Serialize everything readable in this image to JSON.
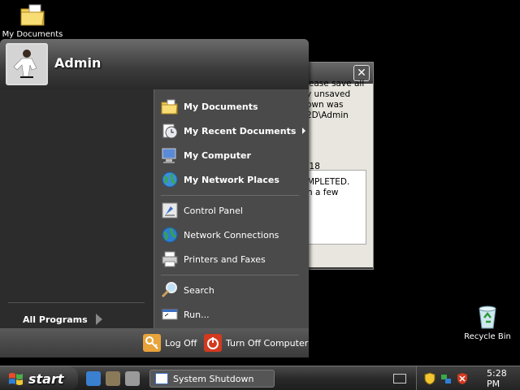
{
  "desktop": {
    "icons": [
      {
        "label": "My Documents",
        "icon": "folder-documents-icon"
      },
      {
        "label": "Recycle Bin",
        "icon": "recycle-bin-icon"
      }
    ]
  },
  "dialog": {
    "message": "lease save all\ny unsaved\nown was\n2D\\Admin",
    "countdown": ":18",
    "status": "MPLETED.\nn a few",
    "close_glyph": "✕"
  },
  "start_menu": {
    "username": "Admin",
    "all_programs": "All Programs",
    "items": [
      {
        "label": "My Documents",
        "icon": "folder-documents-icon",
        "bold": true
      },
      {
        "label": "My Recent Documents",
        "icon": "recent-documents-icon",
        "bold": true,
        "submenu": true
      },
      {
        "label": "My Computer",
        "icon": "computer-icon",
        "bold": true
      },
      {
        "label": "My Network Places",
        "icon": "network-places-icon",
        "bold": true
      },
      {
        "label": "Control Panel",
        "icon": "control-panel-icon"
      },
      {
        "label": "Network Connections",
        "icon": "network-connections-icon"
      },
      {
        "label": "Printers and Faxes",
        "icon": "printer-icon"
      },
      {
        "label": "Search",
        "icon": "search-icon"
      },
      {
        "label": "Run...",
        "icon": "run-icon"
      }
    ],
    "log_off": "Log Off",
    "turn_off": "Turn Off Computer"
  },
  "taskbar": {
    "start_label": "start",
    "task_button": "System Shutdown",
    "clock": "5:28 PM"
  },
  "colors": {
    "accent_blue": "#3a6fc4",
    "turn_off_red": "#d23a1f",
    "log_off_orange": "#e8a33a"
  }
}
